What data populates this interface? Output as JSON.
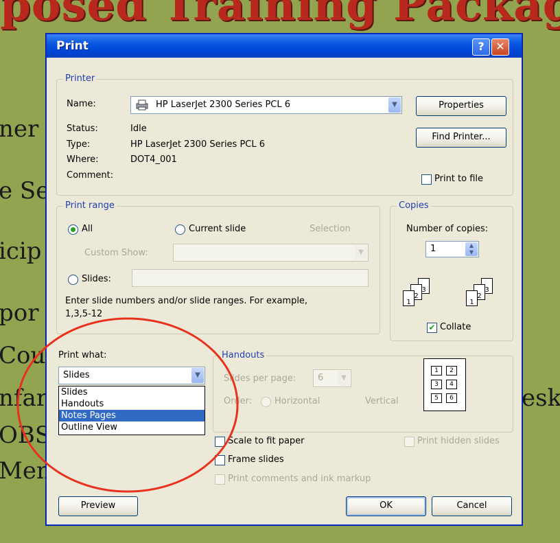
{
  "background": {
    "title_fragment": "posed Training Packag",
    "lines": [
      "ner",
      "e Se",
      "icip",
      "por",
      "Cou",
      "nfar",
      "OBS",
      "Men",
      "eskt"
    ]
  },
  "dialog": {
    "title": "Print",
    "help_button": "?",
    "close_button": "✕"
  },
  "printer": {
    "legend": "Printer",
    "name_label": "Name:",
    "name_value": "HP LaserJet 2300 Series PCL 6",
    "status_label": "Status:",
    "status_value": "Idle",
    "type_label": "Type:",
    "type_value": "HP LaserJet 2300 Series PCL 6",
    "where_label": "Where:",
    "where_value": "DOT4_001",
    "comment_label": "Comment:",
    "properties_button": "Properties",
    "find_printer_button": "Find Printer...",
    "print_to_file_label": "Print to file"
  },
  "print_range": {
    "legend": "Print range",
    "all_label": "All",
    "current_slide_label": "Current slide",
    "selection_label": "Selection",
    "custom_show_label": "Custom Show:",
    "slides_label": "Slides:",
    "hint": "Enter slide numbers and/or slide ranges. For example,",
    "hint_example": "1,3,5-12"
  },
  "copies": {
    "legend": "Copies",
    "number_label": "Number of copies:",
    "number_value": "1",
    "collate_label": "Collate",
    "page_numbers": [
      "1",
      "2",
      "3"
    ]
  },
  "print_what": {
    "label": "Print what:",
    "selected": "Slides",
    "options": [
      "Slides",
      "Handouts",
      "Notes Pages",
      "Outline View"
    ],
    "highlighted_index": 2
  },
  "handouts": {
    "legend": "Handouts",
    "slides_per_page_label": "Slides per page:",
    "slides_per_page_value": "6",
    "order_label": "Order:",
    "horizontal_label": "Horizontal",
    "vertical_label": "Vertical",
    "preview_numbers": [
      "1",
      "2",
      "3",
      "4",
      "5",
      "6"
    ]
  },
  "options": {
    "scale_to_fit": "Scale to fit paper",
    "frame_slides": "Frame slides",
    "print_hidden": "Print hidden slides",
    "print_comments": "Print comments and ink markup"
  },
  "footer": {
    "preview_button": "Preview",
    "ok_button": "OK",
    "cancel_button": "Cancel"
  },
  "annotation": {
    "circle_color": "#e8321e"
  }
}
